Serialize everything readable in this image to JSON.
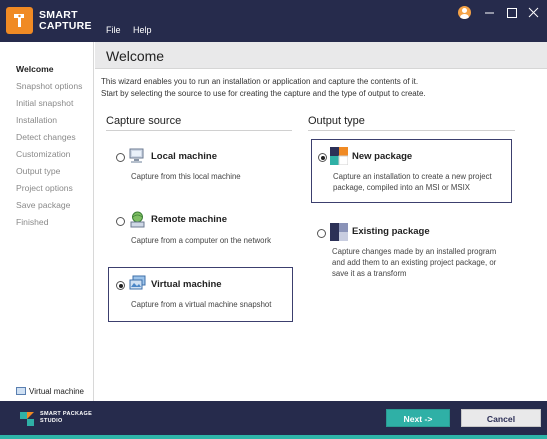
{
  "app": {
    "brand_line1": "SMART",
    "brand_line2": "CAPTURE",
    "menu": [
      "File",
      "Help"
    ]
  },
  "colors": {
    "titlebar": "#262b4c",
    "accent_orange": "#f08a24",
    "accent_teal": "#2fb0a6"
  },
  "sidebar": {
    "steps": [
      "Welcome",
      "Snapshot options",
      "Initial snapshot",
      "Installation",
      "Detect changes",
      "Customization",
      "Output type",
      "Project options",
      "Save package",
      "Finished"
    ],
    "active_index": 0,
    "vm_indicator": "Virtual machine"
  },
  "main": {
    "title": "Welcome",
    "intro_line1": "This wizard enables you to run an installation or application and capture the contents of it.",
    "intro_line2": "Start by selecting the source to use for creating the capture and the type of output to create."
  },
  "capture_source": {
    "heading": "Capture source",
    "options": [
      {
        "title": "Local machine",
        "desc": "Capture from this local machine",
        "selected": false,
        "icon": "computer-icon"
      },
      {
        "title": "Remote machine",
        "desc": "Capture from a computer on the network",
        "selected": false,
        "icon": "network-computer-icon"
      },
      {
        "title": "Virtual machine",
        "desc": "Capture from a virtual machine snapshot",
        "selected": true,
        "icon": "virtual-machine-icon"
      }
    ]
  },
  "output_type": {
    "heading": "Output type",
    "options": [
      {
        "title": "New package",
        "desc": "Capture an installation to create a new project package, compiled into an MSI or MSIX",
        "selected": true,
        "icon": "new-package-icon"
      },
      {
        "title": "Existing package",
        "desc": "Capture changes made by an installed program and add them to an existing project package, or save it as a transform",
        "selected": false,
        "icon": "existing-package-icon"
      }
    ]
  },
  "footer": {
    "brand_line1": "SMART PACKAGE",
    "brand_line2": "STUDIO",
    "next_label": "Next ->",
    "cancel_label": "Cancel"
  }
}
